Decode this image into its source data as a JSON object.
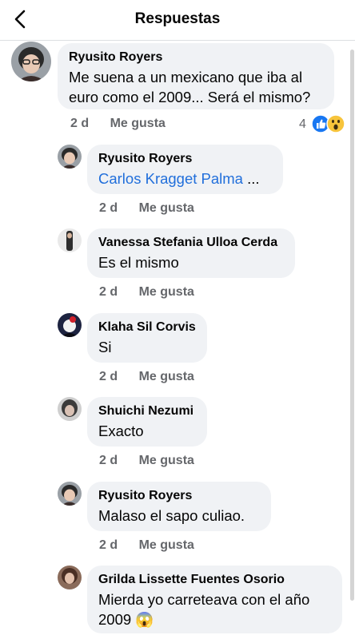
{
  "header": {
    "title": "Respuestas"
  },
  "main_comment": {
    "author": "Ryusito Royers",
    "text": "Me suena a un mexicano que iba al euro como el 2009... Será el mismo?",
    "time": "2 d",
    "like_label": "Me gusta",
    "reaction_count": "4"
  },
  "replies": [
    {
      "author": "Ryusito Royers",
      "mention": "Carlos Kragget Palma",
      "text": " ...",
      "time": "2 d",
      "like_label": "Me gusta"
    },
    {
      "author": "Vanessa Stefania Ulloa Cerda",
      "text": "Es el mismo",
      "time": "2 d",
      "like_label": "Me gusta"
    },
    {
      "author": "Klaha Sil Corvis",
      "text": "Si",
      "time": "2 d",
      "like_label": "Me gusta"
    },
    {
      "author": "Shuichi Nezumi",
      "text": "Exacto",
      "time": "2 d",
      "like_label": "Me gusta"
    },
    {
      "author": "Ryusito Royers",
      "text": "Malaso el sapo culiao.",
      "time": "2 d",
      "like_label": "Me gusta"
    },
    {
      "author": "Grilda Lissette Fuentes Osorio",
      "text": "Mierda yo carreteava con el año 2009",
      "emoji": "😱"
    }
  ],
  "icons": {
    "back": "chevron-left-icon",
    "like_reaction": "thumbs-up-icon",
    "wow_reaction": "wow-face-icon",
    "scared_emoji": "scream-emoji-icon"
  }
}
